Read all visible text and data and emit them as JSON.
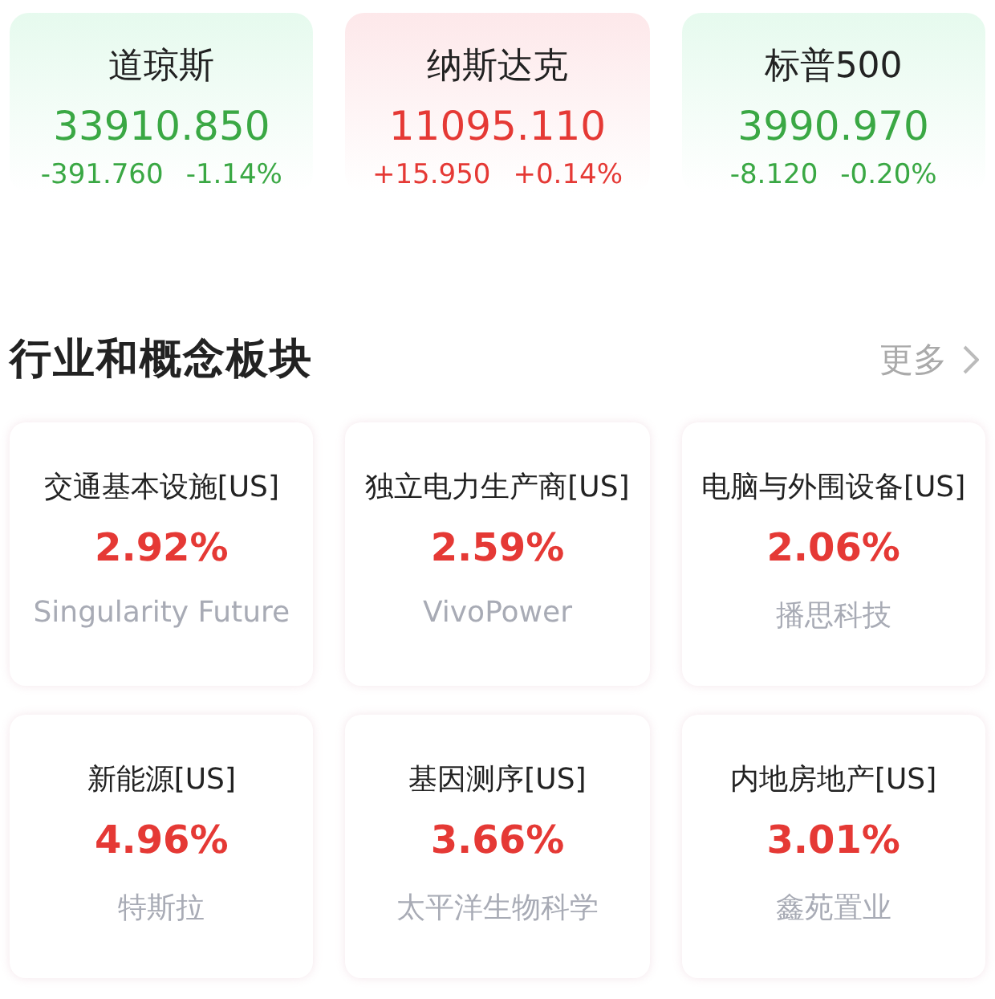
{
  "indices": [
    {
      "name": "道琼斯",
      "price": "33910.850",
      "change": "-391.760",
      "percent": "-1.14%",
      "rising": false
    },
    {
      "name": "纳斯达克",
      "price": "11095.110",
      "change": "+15.950",
      "percent": "+0.14%",
      "rising": true
    },
    {
      "name": "标普500",
      "price": "3990.970",
      "change": "-8.120",
      "percent": "-0.20%",
      "rising": false
    }
  ],
  "section": {
    "title": "行业和概念板块",
    "more": "更多"
  },
  "sectors": [
    {
      "name": "交通基本设施[US]",
      "percent": "2.92%",
      "leader": "Singularity Future",
      "rising": true
    },
    {
      "name": "独立电力生产商[US]",
      "percent": "2.59%",
      "leader": "VivoPower",
      "rising": true
    },
    {
      "name": "电脑与外围设备[US]",
      "percent": "2.06%",
      "leader": "播思科技",
      "rising": true
    },
    {
      "name": "新能源[US]",
      "percent": "4.96%",
      "leader": "特斯拉",
      "rising": true
    },
    {
      "name": "基因测序[US]",
      "percent": "3.66%",
      "leader": "太平洋生物科学",
      "rising": true
    },
    {
      "name": "内地房地产[US]",
      "percent": "3.01%",
      "leader": "鑫苑置业",
      "rising": true
    }
  ]
}
